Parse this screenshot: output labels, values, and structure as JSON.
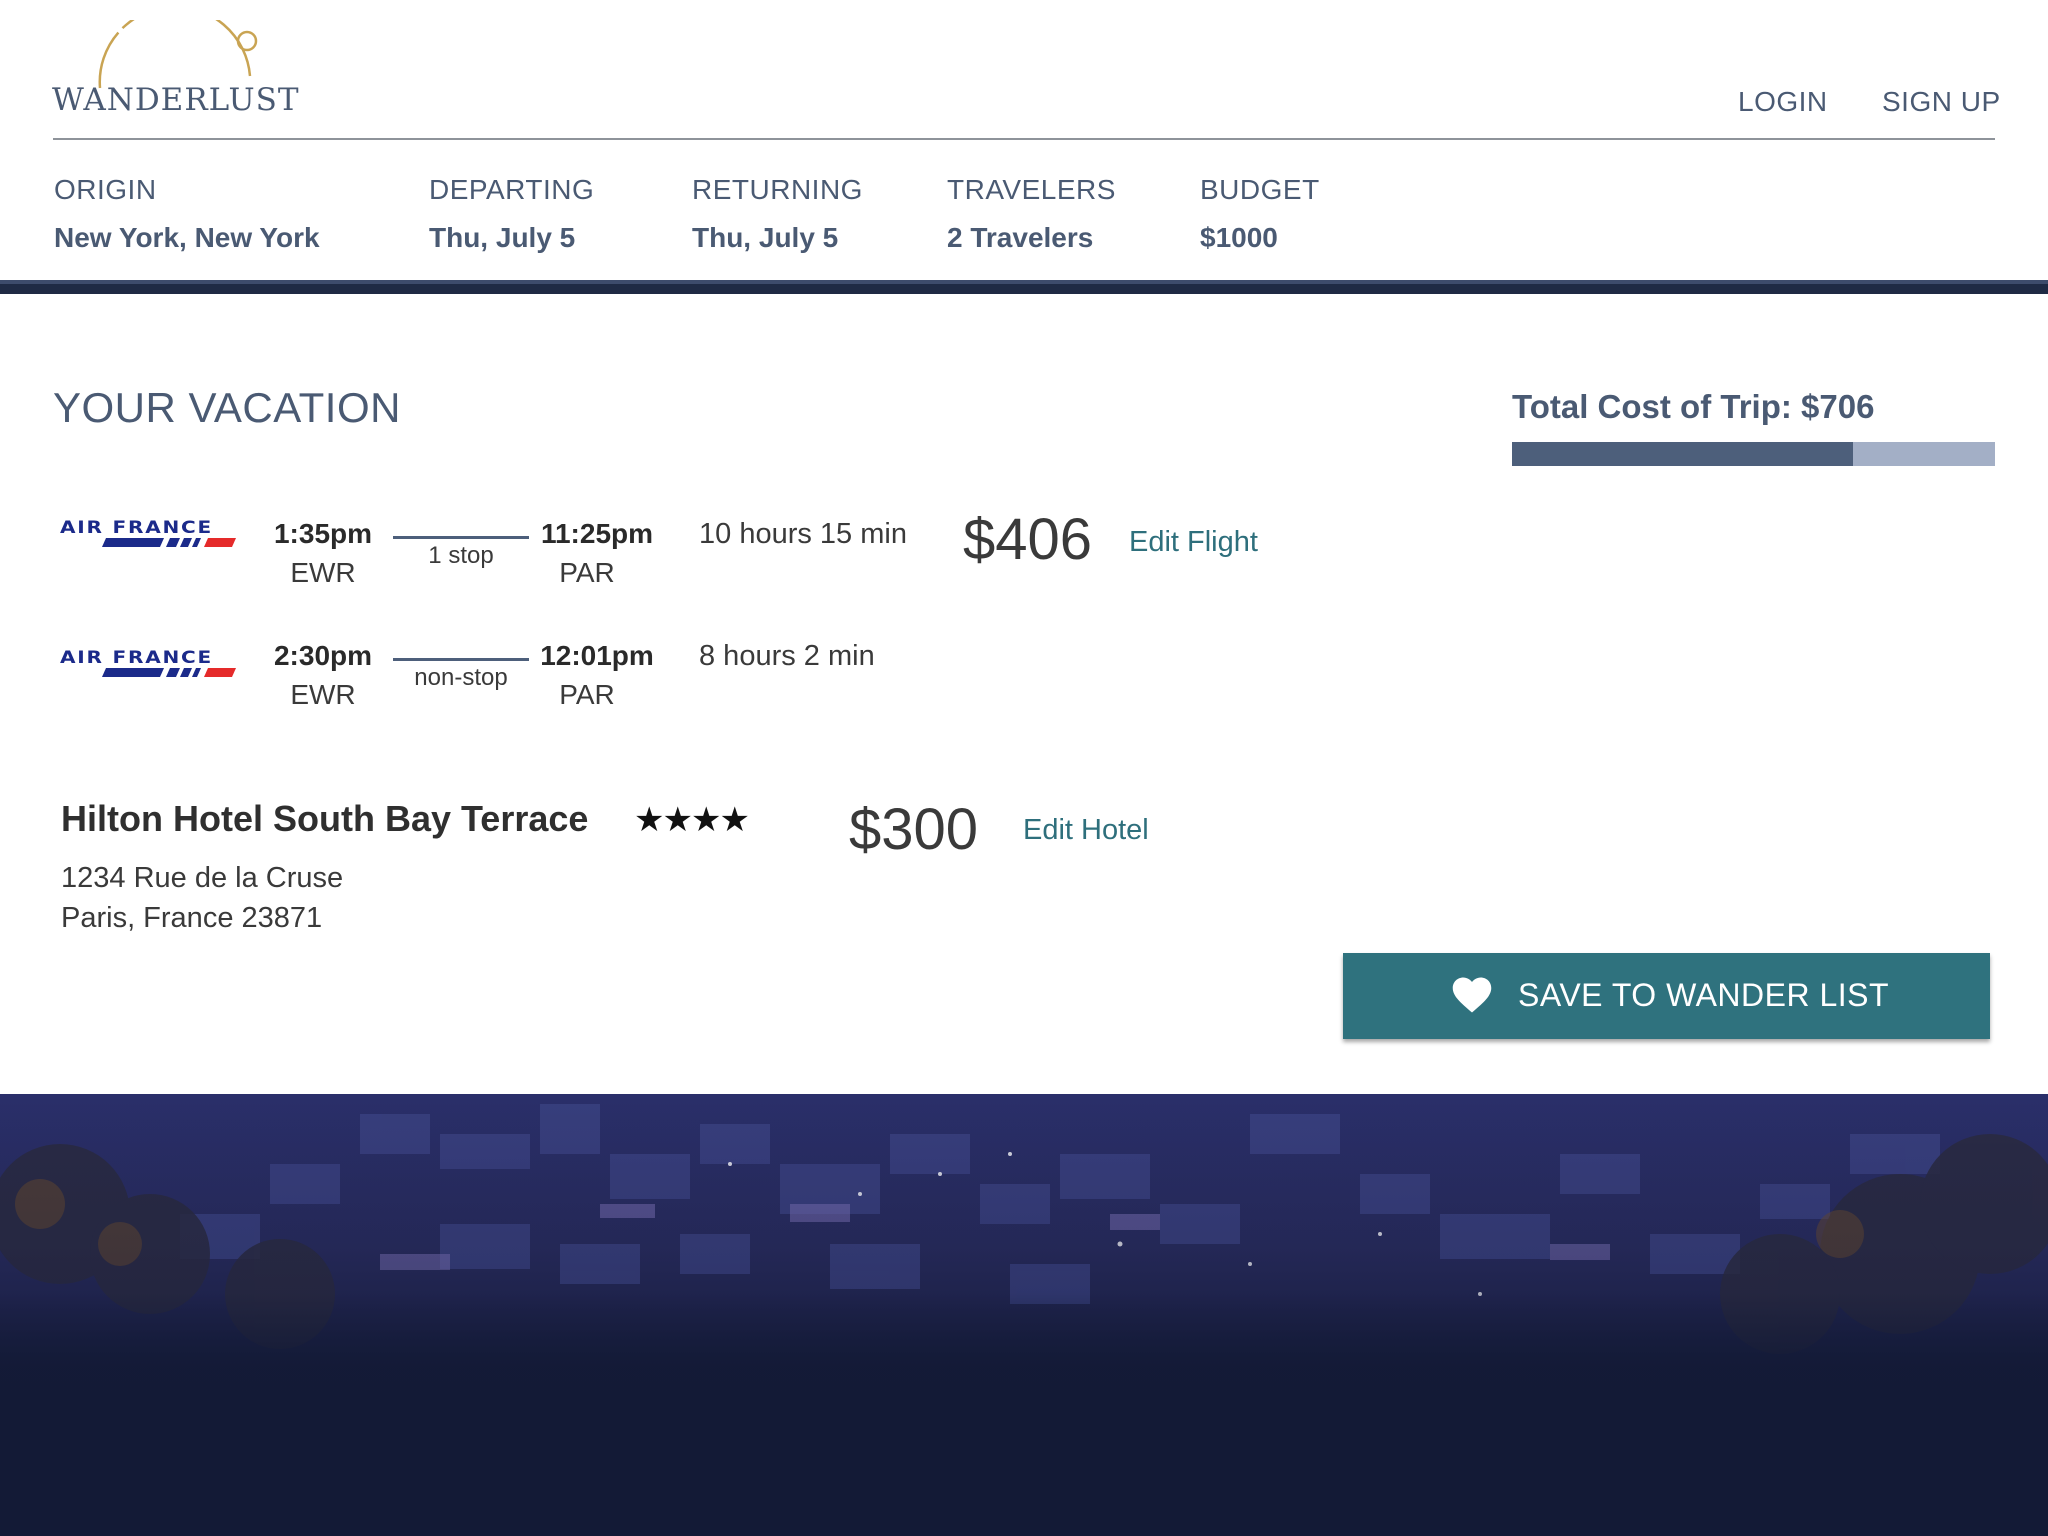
{
  "header": {
    "logo_text": "WANDERLUST",
    "nav": {
      "login": "LOGIN",
      "signup": "SIGN UP"
    }
  },
  "search": {
    "origin": {
      "label": "ORIGIN",
      "value": "New York, New York"
    },
    "departing": {
      "label": "DEPARTING",
      "value": "Thu, July 5"
    },
    "returning": {
      "label": "RETURNING",
      "value": "Thu, July 5"
    },
    "travelers": {
      "label": "TRAVELERS",
      "value": "2 Travelers"
    },
    "budget": {
      "label": "BUDGET",
      "value": "$1000"
    }
  },
  "vacation": {
    "title": "YOUR VACATION",
    "total_cost": "Total Cost of Trip: $706",
    "budget_used_fraction": 0.706,
    "flights": [
      {
        "airline": "AIR FRANCE",
        "depart_time": "1:35pm",
        "depart_airport": "EWR",
        "stops": "1 stop",
        "arrive_time": "11:25pm",
        "arrive_airport": "PAR",
        "duration": "10 hours 15 min"
      },
      {
        "airline": "AIR FRANCE",
        "depart_time": "2:30pm",
        "depart_airport": "EWR",
        "stops": "non-stop",
        "arrive_time": "12:01pm",
        "arrive_airport": "PAR",
        "duration": "8 hours 2 min"
      }
    ],
    "flight_price": "$406",
    "edit_flight": "Edit Flight",
    "hotel": {
      "name": "Hilton Hotel South Bay Terrace",
      "stars": "★★★★",
      "address_line1": "1234 Rue de la Cruse",
      "address_line2": "Paris, France 23871",
      "price": "$300",
      "edit_label": "Edit Hotel"
    },
    "save_button": "SAVE TO WANDER LIST"
  },
  "colors": {
    "text": "#4a5a73",
    "accent_teal": "#2f727e",
    "link": "#2e6f7c",
    "navy_band": "#1f2a44",
    "logo_gold": "#c9a453"
  }
}
